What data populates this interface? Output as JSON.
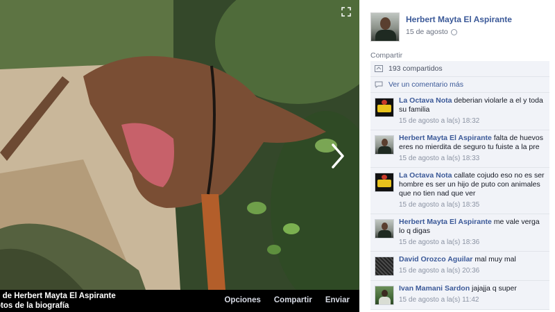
{
  "photo": {
    "caption_line1": "s de Herbert Mayta El Aspirante",
    "caption_line2": "otos de la biografía",
    "actions": {
      "options": "Opciones",
      "share": "Compartir",
      "send": "Enviar"
    }
  },
  "post": {
    "author": "Herbert Mayta El Aspirante",
    "date": "15 de agosto",
    "share_label": "Compartir",
    "shares": "193 compartidos",
    "view_comment": "Ver un comentario más"
  },
  "comments": [
    {
      "author": "La Octava Nota",
      "text": "deberian violarle a el y toda su familia",
      "time": "15 de agosto a la(s) 18:32"
    },
    {
      "author": "Herbert Mayta El Aspirante",
      "text": "falta de huevos eres no mierdita de seguro tu fuiste a la pre",
      "time": "15 de agosto a la(s) 18:33"
    },
    {
      "author": "La Octava Nota",
      "text": "callate cojudo eso no es ser hombre es ser un hijo de puto con animales que no tien nad que ver",
      "time": "15 de agosto a la(s) 18:35"
    },
    {
      "author": "Herbert Mayta El Aspirante",
      "text": "me vale verga lo q digas",
      "time": "15 de agosto a la(s) 18:36"
    },
    {
      "author": "David Orozco Aguilar",
      "text": "mal muy mal",
      "time": "15 de agosto a la(s) 20:36"
    },
    {
      "author": "Ivan Mamani Sardon",
      "text": "jajajja q super",
      "time": "15 de agosto a la(s) 11:42"
    }
  ]
}
